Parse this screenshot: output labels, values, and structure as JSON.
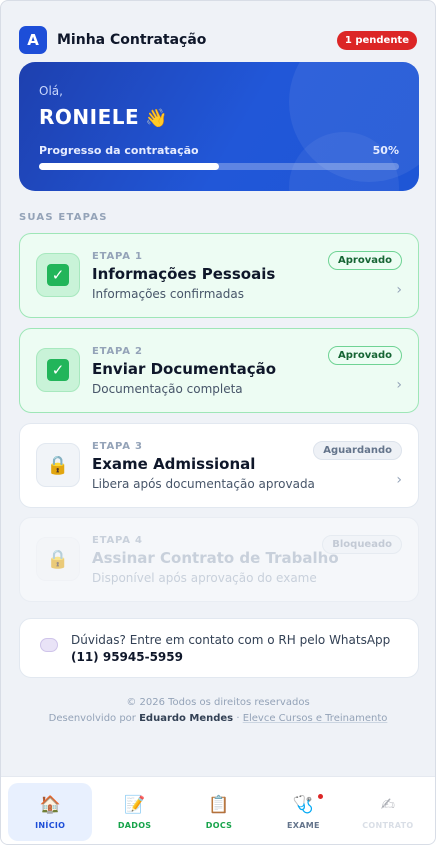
{
  "header": {
    "logo_letter": "A",
    "title": "Minha Contratação",
    "pending_badge": "1 pendente"
  },
  "hero": {
    "greeting": "Olá,",
    "name": "RONIELE",
    "wave_icon": "👋",
    "progress_label": "Progresso da contratação",
    "progress_text": "50%",
    "progress_fraction": 0.5
  },
  "steps_section": {
    "title": "SUAS ETAPAS",
    "items": [
      {
        "kicker": "ETAPA 1",
        "title": "Informações Pessoais",
        "subtitle": "Informações confirmadas",
        "badge": "Aprovado",
        "chevron": "›",
        "status": "done",
        "icon": "check-icon"
      },
      {
        "kicker": "ETAPA 2",
        "title": "Enviar Documentação",
        "subtitle": "Documentação completa",
        "badge": "Aprovado",
        "chevron": "›",
        "status": "done",
        "icon": "check-icon"
      },
      {
        "kicker": "ETAPA 3",
        "title": "Exame Admissional",
        "subtitle": "Libera após documentação aprovada",
        "badge": "Aguardando",
        "chevron": "›",
        "status": "waiting",
        "icon": "🔒"
      },
      {
        "kicker": "ETAPA 4",
        "title": "Assinar Contrato de Trabalho",
        "subtitle": "Disponível após aprovação do exame",
        "badge": "Bloqueado",
        "status": "locked",
        "icon": "🔒"
      }
    ]
  },
  "help": {
    "text": "Dúvidas? Entre em contato com o RH pelo WhatsApp ",
    "phone": "(11) 95945-5959",
    "icon": "speech-bubble-icon"
  },
  "footer": {
    "copyright": "© 2026 Todos os direitos reservados",
    "dev_prefix": "Desenvolvido por ",
    "developer": "Eduardo Mendes",
    "separator": " · ",
    "brand": "Elevce Cursos e Treinamento"
  },
  "bottom_nav": {
    "items": [
      {
        "label": "INÍCIO",
        "icon": "🏠",
        "state": "active"
      },
      {
        "label": "DADOS",
        "icon": "📝",
        "state": "done"
      },
      {
        "label": "DOCS",
        "icon": "📋",
        "state": "done"
      },
      {
        "label": "EXAME",
        "icon": "🩺",
        "state": "pending"
      },
      {
        "label": "CONTRATO",
        "icon": "✍",
        "state": "disabled"
      }
    ]
  },
  "colors": {
    "brand_blue": "#1d4ed8",
    "success_green": "#22b55a",
    "alert_red": "#dc2626"
  }
}
